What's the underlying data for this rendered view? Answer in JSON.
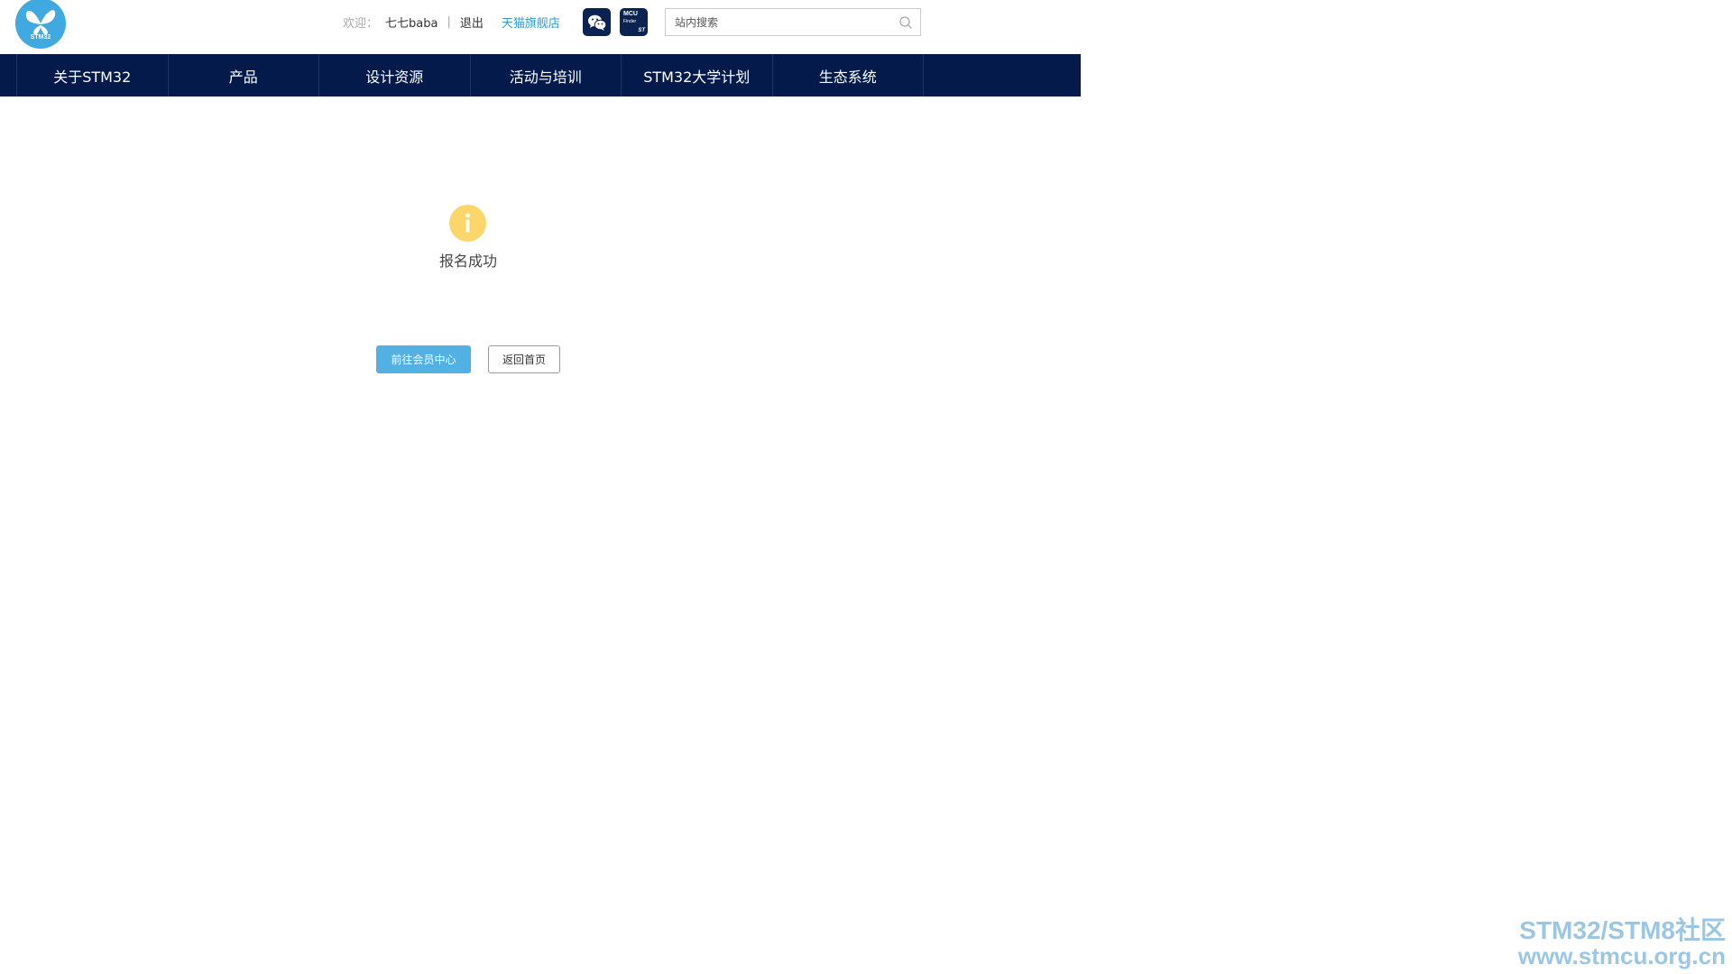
{
  "header": {
    "logo_text": "STM32",
    "welcome": "欢迎：",
    "username": "七七baba",
    "separator": "|",
    "logout": "退出",
    "tmall": "天猫旗舰店",
    "mcu_text": "MCU",
    "mcu_sub": "Finder",
    "mcu_brand": "ST",
    "search_placeholder": "站内搜索"
  },
  "nav": {
    "items": [
      {
        "label": "关于STM32"
      },
      {
        "label": "产品"
      },
      {
        "label": "设计资源"
      },
      {
        "label": "活动与培训"
      },
      {
        "label": "STM32大学计划"
      },
      {
        "label": "生态系统"
      }
    ]
  },
  "message": {
    "icon": "info-icon",
    "text": "报名成功"
  },
  "buttons": {
    "member_center": "前往会员中心",
    "back_home": "返回首页"
  },
  "watermark": {
    "line1": "STM32/STM8社区",
    "line2": "www.stmcu.org.cn"
  },
  "colors": {
    "nav_bg": "#031a4a",
    "accent_blue": "#52b0e2",
    "link_blue": "#3399cc",
    "info_yellow": "#fbd76b",
    "logo_blue": "#3fa9e0"
  }
}
